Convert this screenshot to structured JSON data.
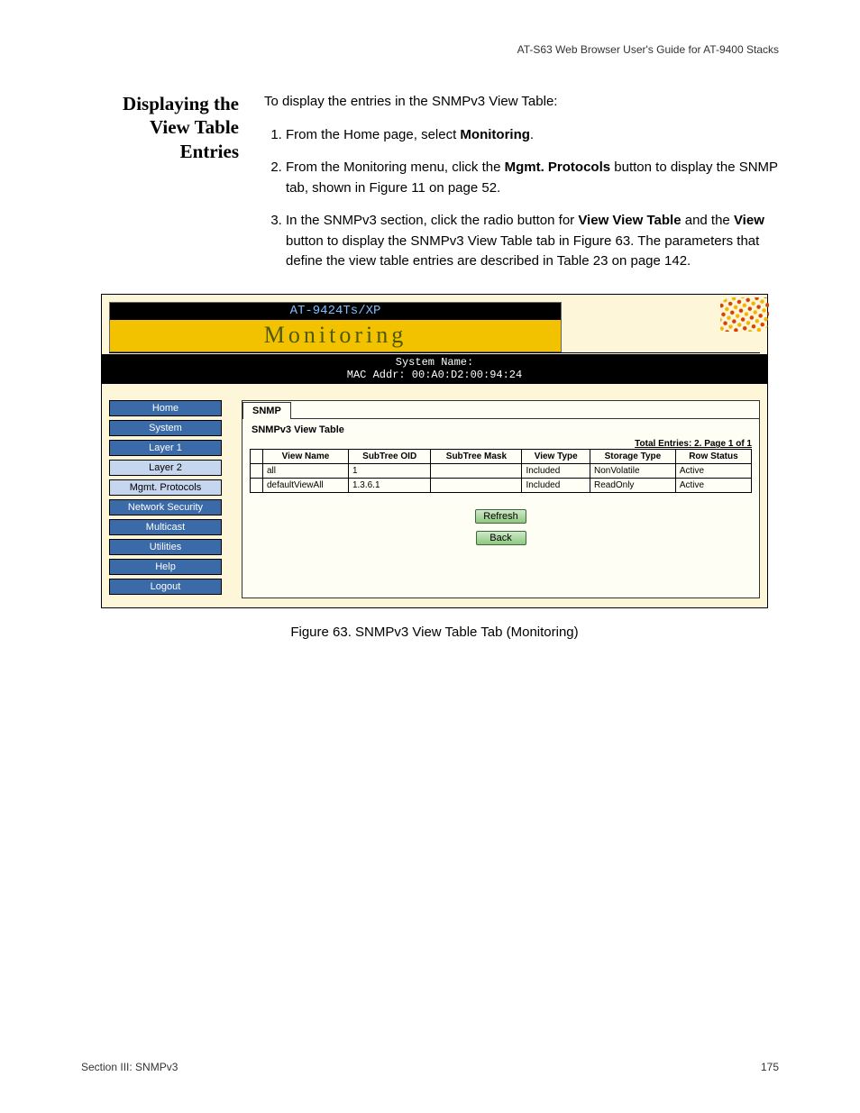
{
  "header": {
    "running": "AT-S63 Web Browser User's Guide for AT-9400 Stacks"
  },
  "side_heading": {
    "l1": "Displaying the",
    "l2": "View Table",
    "l3": "Entries"
  },
  "body": {
    "intro": "To display the entries in the SNMPv3 View Table:",
    "step1_pre": "From the Home page, select ",
    "step1_bold": "Monitoring",
    "step1_post": ".",
    "step2_pre": "From the Monitoring menu, click the ",
    "step2_bold": "Mgmt. Protocols",
    "step2_post": " button to display the SNMP tab, shown in Figure 11 on page 52.",
    "step3_pre": "In the SNMPv3 section, click the radio button for ",
    "step3_bold1": "View View Table",
    "step3_mid": " and the ",
    "step3_bold2": "View",
    "step3_post": " button to display the SNMPv3 View Table tab in Figure 63. The parameters that define the view table entries are described in Table 23 on page 142."
  },
  "screenshot": {
    "model": "AT-9424Ts/XP",
    "title": "Monitoring",
    "sys_name_label": "System Name:",
    "mac_label": "MAC Addr: 00:A0:D2:00:94:24",
    "nav": [
      "Home",
      "System",
      "Layer 1",
      "Layer 2",
      "Mgmt. Protocols",
      "Network Security",
      "Multicast",
      "Utilities",
      "Help",
      "Logout"
    ],
    "nav_light": [
      3,
      4
    ],
    "tab": "SNMP",
    "panel_title": "SNMPv3 View Table",
    "entries_line": "Total Entries: 2. Page 1 of 1",
    "columns": [
      "",
      "View Name",
      "SubTree OID",
      "SubTree Mask",
      "View Type",
      "Storage Type",
      "Row Status"
    ],
    "rows": [
      {
        "view_name": "all",
        "subtree_oid": "1",
        "subtree_mask": "",
        "view_type": "Included",
        "storage_type": "NonVolatile",
        "row_status": "Active"
      },
      {
        "view_name": "defaultViewAll",
        "subtree_oid": "1.3.6.1",
        "subtree_mask": "",
        "view_type": "Included",
        "storage_type": "ReadOnly",
        "row_status": "Active"
      }
    ],
    "btn_refresh": "Refresh",
    "btn_back": "Back"
  },
  "chart_data": {
    "type": "table",
    "title": "SNMPv3 View Table",
    "columns": [
      "View Name",
      "SubTree OID",
      "SubTree Mask",
      "View Type",
      "Storage Type",
      "Row Status"
    ],
    "rows": [
      [
        "all",
        "1",
        "",
        "Included",
        "NonVolatile",
        "Active"
      ],
      [
        "defaultViewAll",
        "1.3.6.1",
        "",
        "Included",
        "ReadOnly",
        "Active"
      ]
    ]
  },
  "caption": "Figure 63. SNMPv3 View Table Tab (Monitoring)",
  "footer": {
    "left": "Section III: SNMPv3",
    "right": "175"
  }
}
